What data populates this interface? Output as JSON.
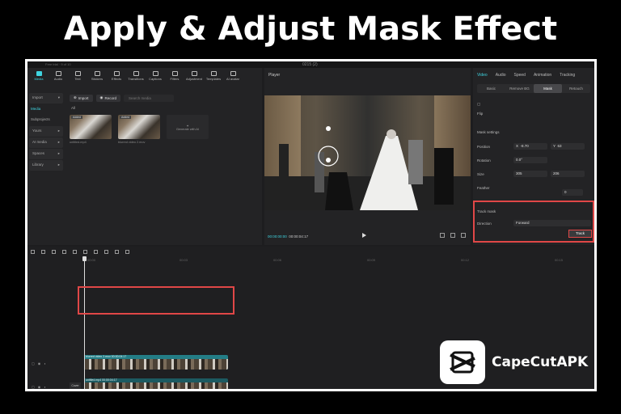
{
  "headline": "Apply & Adjust Mask Effect",
  "colors": {
    "accent": "#3fd4e0",
    "highlight": "#e04747",
    "clip": "#237d86"
  },
  "window": {
    "title": "0215 (2)",
    "left_label": "Free trial · 9 of 10"
  },
  "toolbar": [
    {
      "label": "Media",
      "active": true
    },
    {
      "label": "Audio"
    },
    {
      "label": "Text"
    },
    {
      "label": "Stickers"
    },
    {
      "label": "Effects"
    },
    {
      "label": "Transitions"
    },
    {
      "label": "Captions"
    },
    {
      "label": "Filters"
    },
    {
      "label": "Adjustment"
    },
    {
      "label": "Templates"
    },
    {
      "label": "AI avatar"
    }
  ],
  "sidebar": {
    "import": "Import",
    "media": "Media",
    "subprojects": "Subprojects",
    "yours": "Yours",
    "ai_media": "AI media",
    "spaces": "Spaces",
    "library": "Library"
  },
  "media": {
    "import_btn": "Import",
    "record_btn": "Record",
    "search_placeholder": "Search media",
    "all": "All",
    "items": [
      {
        "badge": "Added",
        "name": "untitled.mp4"
      },
      {
        "badge": "Added",
        "name": "blurred video 2.mov"
      },
      {
        "name": "Generate with AI"
      }
    ]
  },
  "player": {
    "title": "Player",
    "time_current": "00:00:00:00",
    "time_total": "00:00:04:17"
  },
  "inspector": {
    "tabs": [
      "Video",
      "Audio",
      "Speed",
      "Animation",
      "Tracking"
    ],
    "subtabs": [
      "Basic",
      "Remove BG",
      "Mask",
      "Retouch"
    ],
    "mask_settings": "Mask settings",
    "flip": "Flip",
    "position_label": "Position",
    "x_label": "X",
    "x_value": "-8.70",
    "y_label": "Y",
    "y_value": "63",
    "rotation_label": "Rotation",
    "rotation_value": "0.0°",
    "size_label": "Size",
    "w_value": "305",
    "h_value": "206",
    "feather_label": "Feather",
    "feather_value": "0",
    "track_mask": "Track mask",
    "direction_label": "Direction",
    "direction_value": "Forward",
    "track_btn": "Track"
  },
  "timeline": {
    "ruler": [
      "00:00",
      "00:03",
      "00:06",
      "00:09",
      "00:12",
      "00:15"
    ],
    "top_clip": "blurred video 2.mov  00:00:04:17",
    "main_clip": "untitled.mp4  00:00:04:17",
    "cover": "Cover"
  },
  "brand": {
    "name": "CapeCutAPK"
  }
}
